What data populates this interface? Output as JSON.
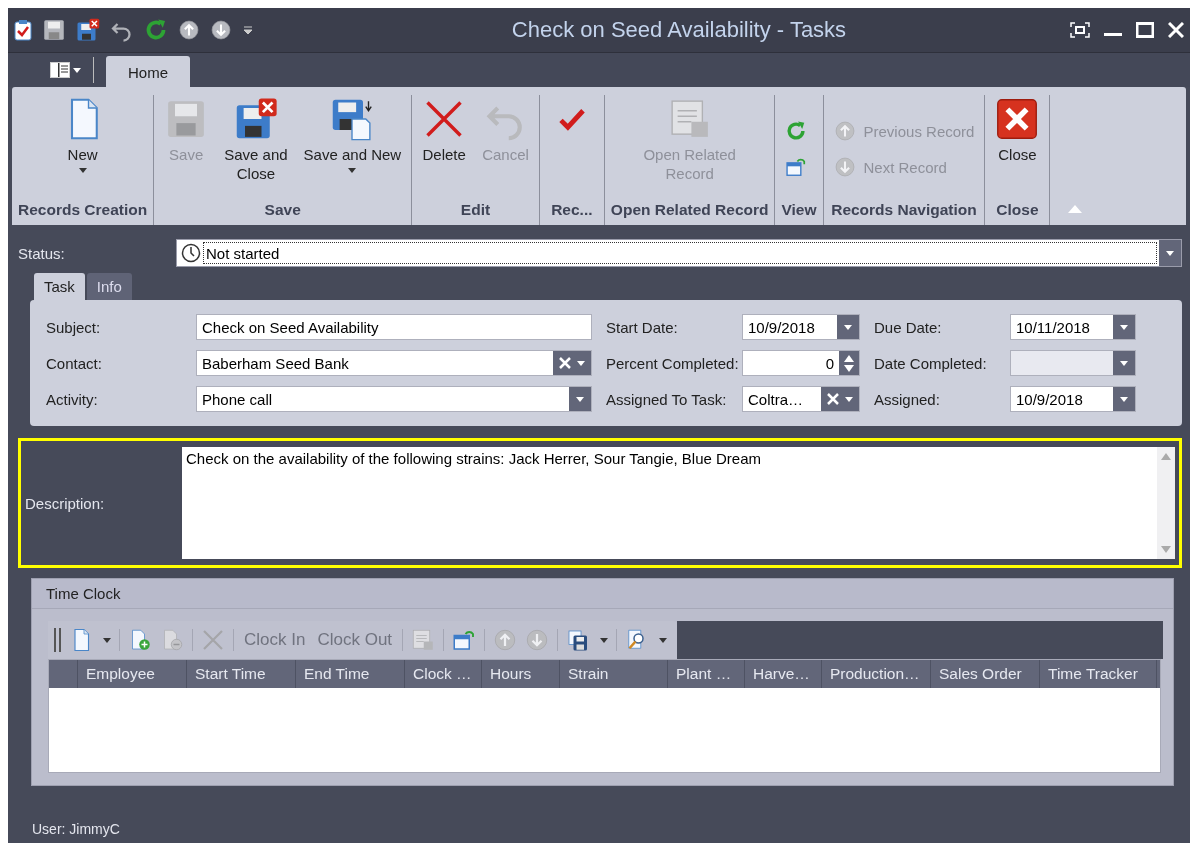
{
  "window": {
    "title": "Check on Seed Availability - Tasks"
  },
  "ribbon": {
    "tabs": [
      {
        "label": "Home",
        "selected": true
      }
    ],
    "groups": [
      {
        "caption": "Records Creation",
        "kind": "large",
        "buttons": [
          {
            "kind": "new",
            "label": "New",
            "dropdown": true,
            "disabled": false
          }
        ]
      },
      {
        "caption": "Save",
        "kind": "large",
        "buttons": [
          {
            "kind": "save",
            "label": "Save",
            "disabled": true
          },
          {
            "kind": "save-close",
            "label": "Save and\nClose",
            "disabled": false
          },
          {
            "kind": "save-new",
            "label": "Save and New",
            "dropdown": true,
            "disabled": false
          }
        ]
      },
      {
        "caption": "Edit",
        "kind": "large",
        "buttons": [
          {
            "kind": "delete",
            "label": "Delete",
            "disabled": false
          },
          {
            "kind": "cancel",
            "label": "Cancel",
            "disabled": true
          }
        ]
      },
      {
        "caption": "Rec...",
        "kind": "large",
        "buttons": [
          {
            "kind": "check",
            "disabled": false
          }
        ]
      },
      {
        "caption": "Open Related Record",
        "kind": "large",
        "buttons": [
          {
            "kind": "related",
            "label": "Open Related\nRecord",
            "disabled": true
          }
        ]
      },
      {
        "caption": "View",
        "kind": "small",
        "buttons": [
          {
            "kind": "refresh",
            "disabled": false
          },
          {
            "kind": "window",
            "disabled": false
          }
        ]
      },
      {
        "caption": "Records Navigation",
        "kind": "small",
        "buttons": [
          {
            "kind": "up",
            "label": "Previous Record",
            "disabled": true
          },
          {
            "kind": "down",
            "label": "Next Record",
            "disabled": true
          }
        ]
      },
      {
        "caption": "Close",
        "kind": "large",
        "buttons": [
          {
            "kind": "close",
            "label": "Close",
            "disabled": false
          }
        ]
      }
    ]
  },
  "status": {
    "label": "Status:",
    "value": "Not started"
  },
  "form_tabs": [
    {
      "label": "Task",
      "selected": true
    },
    {
      "label": "Info",
      "selected": false
    }
  ],
  "task_rows": [
    [
      {
        "label": "Subject:",
        "value": "Check on Seed Availability",
        "kind": "text",
        "disabled": false
      },
      {
        "label": "Start Date:",
        "value": "10/9/2018",
        "kind": "date",
        "disabled": false
      },
      {
        "label": "Due Date:",
        "value": "10/11/2018",
        "kind": "date",
        "disabled": false
      }
    ],
    [
      {
        "label": "Contact:",
        "value": "Baberham Seed Bank",
        "kind": "lookup",
        "disabled": false
      },
      {
        "label": "Percent Completed:",
        "value": "0",
        "kind": "spin",
        "disabled": false
      },
      {
        "label": "Date Completed:",
        "kind": "date",
        "disabled": true
      }
    ],
    [
      {
        "label": "Activity:",
        "value": "Phone call",
        "kind": "combo",
        "disabled": false
      },
      {
        "label": "Assigned To Task:",
        "value": "Coltra…",
        "kind": "lookup",
        "disabled": false
      },
      {
        "label": "Assigned:",
        "value": "10/9/2018",
        "kind": "date",
        "disabled": false
      }
    ]
  ],
  "description": {
    "label": "Description:",
    "value": "Check on the availability of the following strains: Jack Herrer, Sour Tangie, Blue Dream"
  },
  "time_clock": {
    "title": "Time Clock",
    "toolbar": [
      {
        "kind": "new",
        "dropdown": true,
        "disabled": false
      },
      {
        "kind": "separator"
      },
      {
        "kind": "add",
        "disabled": false
      },
      {
        "kind": "remove",
        "disabled": true
      },
      {
        "kind": "separator"
      },
      {
        "kind": "delete",
        "disabled": true
      },
      {
        "kind": "separator"
      },
      {
        "kind": "text",
        "label": "Clock In",
        "disabled": true
      },
      {
        "kind": "text",
        "label": "Clock Out",
        "disabled": true
      },
      {
        "kind": "separator"
      },
      {
        "kind": "related",
        "disabled": true
      },
      {
        "kind": "separator"
      },
      {
        "kind": "window",
        "disabled": false
      },
      {
        "kind": "separator"
      },
      {
        "kind": "up",
        "disabled": true
      },
      {
        "kind": "down",
        "disabled": true
      },
      {
        "kind": "separator"
      },
      {
        "kind": "save-export",
        "dropdown": true,
        "disabled": false
      },
      {
        "kind": "separator"
      },
      {
        "kind": "preview",
        "dropdown": true,
        "disabled": false
      }
    ],
    "columns": [
      "Employee",
      "Start Time",
      "End Time",
      "Clock …",
      "Hours",
      "Strain",
      "Plant …",
      "Harve…",
      "Production…",
      "Sales Order",
      "Time Tracker"
    ]
  },
  "status_bar": "User: JimmyC"
}
